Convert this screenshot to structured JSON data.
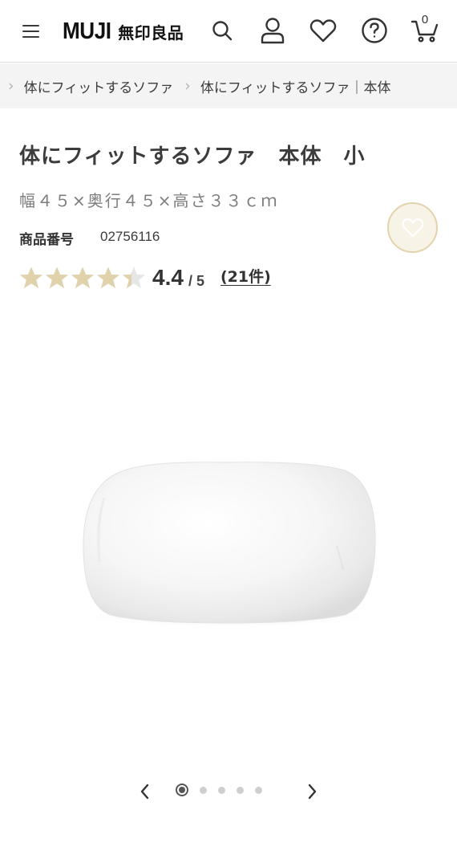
{
  "header": {
    "logo_en": "MUJI",
    "logo_jp": "無印良品",
    "icons": [
      "menu-icon",
      "search-icon",
      "account-icon",
      "favorites-icon",
      "help-icon",
      "cart-icon"
    ],
    "cart_count": "0"
  },
  "breadcrumb": {
    "items": [
      {
        "label": "体にフィットするソファ"
      },
      {
        "label": "体にフィットするソファ｜本体"
      }
    ]
  },
  "product": {
    "title": "体にフィットするソファ　本体　小",
    "size": "幅４５×奥行４５×高さ３３ｃｍ",
    "number_label": "商品番号",
    "number": "02756116",
    "rating": 4.4,
    "rating_display": "4.4",
    "rating_max": "/ 5",
    "reviews": "(21件)"
  },
  "carousel": {
    "total": 5,
    "current": 1
  },
  "colors": {
    "star": "#e0d2ab",
    "star_empty": "#e6e6e6",
    "favorite_bg": "#f8f3e7",
    "favorite_border": "#e3d3ac",
    "breadcrumb_bg": "#f4f4f4"
  }
}
